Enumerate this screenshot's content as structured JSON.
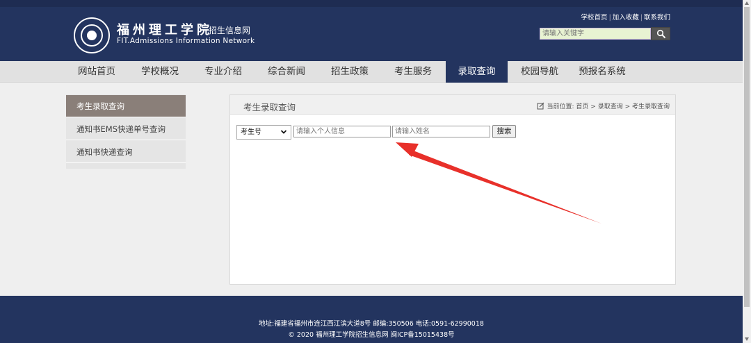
{
  "header": {
    "logo_cn": "福州理工学院",
    "logo_sub": "招生信息网",
    "logo_en": "FIT.Admissions Information Network",
    "top_links": [
      "学校首页",
      "加入收藏",
      "联系我们"
    ],
    "search_placeholder": "请输入关键字"
  },
  "nav": {
    "items": [
      "网站首页",
      "学校概况",
      "专业介绍",
      "综合新闻",
      "招生政策",
      "考生服务",
      "录取查询",
      "校园导航",
      "预报名系统"
    ],
    "active": "录取查询"
  },
  "sidebar": {
    "items": [
      "考生录取查询",
      "通知书EMS快递单号查询",
      "通知书快递查询"
    ]
  },
  "panel": {
    "title": "考生录取查询",
    "crumb_prefix": "当前位置:",
    "crumbs": [
      "首页",
      "录取查询",
      "考生录取查询"
    ],
    "crumb_sep": " > "
  },
  "query_form": {
    "select_value": "考生号",
    "input1_placeholder": "请输入个人信息",
    "input2_placeholder": "请输入姓名",
    "submit_label": "搜索"
  },
  "footer": {
    "line1": "地址:福建省福州市连江西江滨大道8号    邮编:350506    电话:0591-62990018",
    "line2": "© 2020 福州理工学院招生信息网  闽ICP备15015438号"
  },
  "colors": {
    "header_bg": "#23345f",
    "nav_bg": "#e1e1e1",
    "active_side": "#8a7f79",
    "annotation_arrow": "#e8302a"
  }
}
